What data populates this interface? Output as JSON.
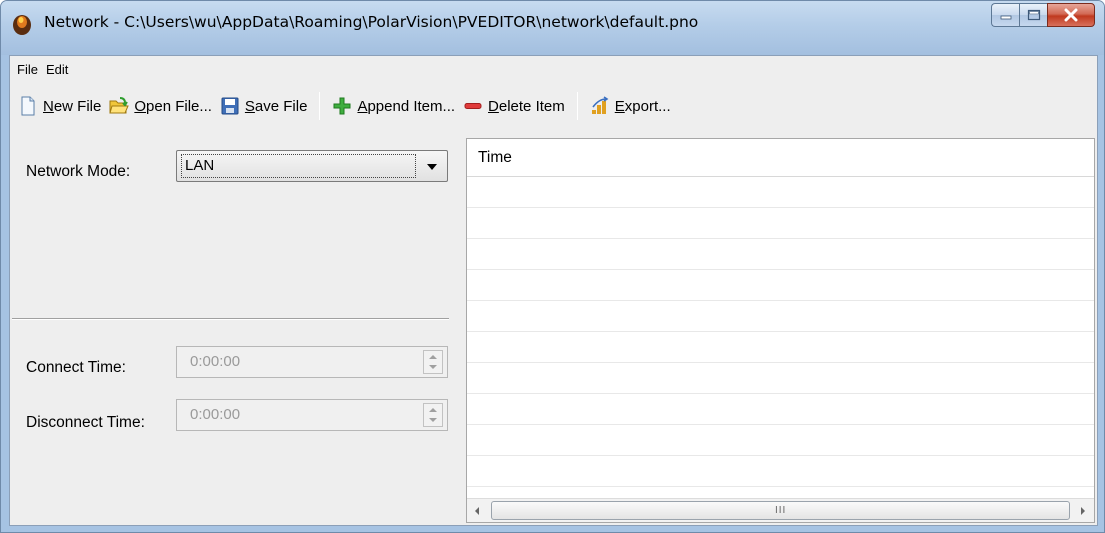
{
  "window": {
    "title": "Network - C:\\Users\\wu\\AppData\\Roaming\\PolarVision\\PVEDITOR\\network\\default.pno",
    "app_icon": "app-logo-icon",
    "caption_buttons": [
      "minimize-icon",
      "maximize-icon",
      "close-icon"
    ]
  },
  "menu": {
    "items": [
      {
        "label": "File"
      },
      {
        "label": "Edit"
      }
    ]
  },
  "toolbar": {
    "new_file": {
      "mnemonic": "N",
      "rest": "ew File",
      "icon": "new-file-icon"
    },
    "open_file": {
      "mnemonic": "O",
      "rest": "pen File...",
      "icon": "open-folder-icon"
    },
    "save_file": {
      "mnemonic": "S",
      "rest": "ave File",
      "icon": "save-icon"
    },
    "append_item": {
      "mnemonic": "A",
      "rest": "ppend Item...",
      "icon": "plus-icon"
    },
    "delete_item": {
      "mnemonic": "D",
      "rest": "elete Item",
      "icon": "minus-icon"
    },
    "export": {
      "mnemonic": "E",
      "rest": "xport...",
      "icon": "export-icon"
    }
  },
  "form": {
    "network_mode_label": "Network Mode:",
    "network_mode_value": "LAN",
    "connect_time_label": "Connect Time:",
    "connect_time_value": "0:00:00",
    "disconnect_time_label": "Disconnect Time:",
    "disconnect_time_value": "0:00:00"
  },
  "table": {
    "columns": [
      "Time"
    ],
    "rows": [],
    "scrollbar_grip": "III"
  },
  "colors": {
    "title_bar": "#b4cde8",
    "client_bg": "#eeeeee",
    "close_button": "#c0391f",
    "add_green": "#2f9e2f",
    "delete_red": "#d9302f"
  }
}
